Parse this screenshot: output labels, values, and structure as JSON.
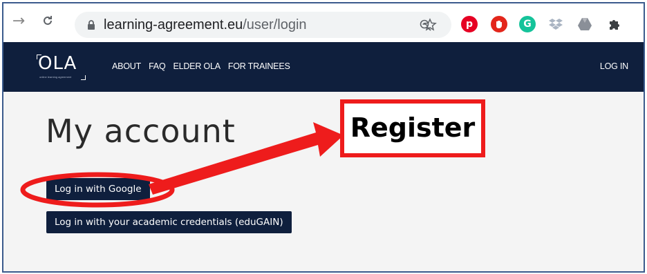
{
  "browser": {
    "url_host": "learning-agreement.eu",
    "url_path": "/user/login",
    "icons": [
      "back-icon",
      "reload-icon",
      "lock-icon",
      "zoom-out-icon",
      "star-icon",
      "pinterest-icon",
      "adblock-icon",
      "grammarly-icon",
      "dropbox-icon",
      "drive-icon",
      "extensions-icon"
    ]
  },
  "header": {
    "logo": "OLA",
    "logo_sub": "online learning agreement",
    "menu": [
      "ABOUT",
      "FAQ",
      "ELDER OLA",
      "FOR TRAINEES"
    ],
    "login": "LOG IN"
  },
  "main": {
    "title": "My account",
    "google_button": "Log in with Google",
    "edugain_button": "Log in with your academic credentials (eduGAIN)"
  },
  "annotation": {
    "label": "Register",
    "color": "#ee1c1c"
  },
  "colors": {
    "header_bg": "#0f1f3d",
    "button_bg": "#0f1f3d",
    "page_bg": "#f4f4f4"
  }
}
